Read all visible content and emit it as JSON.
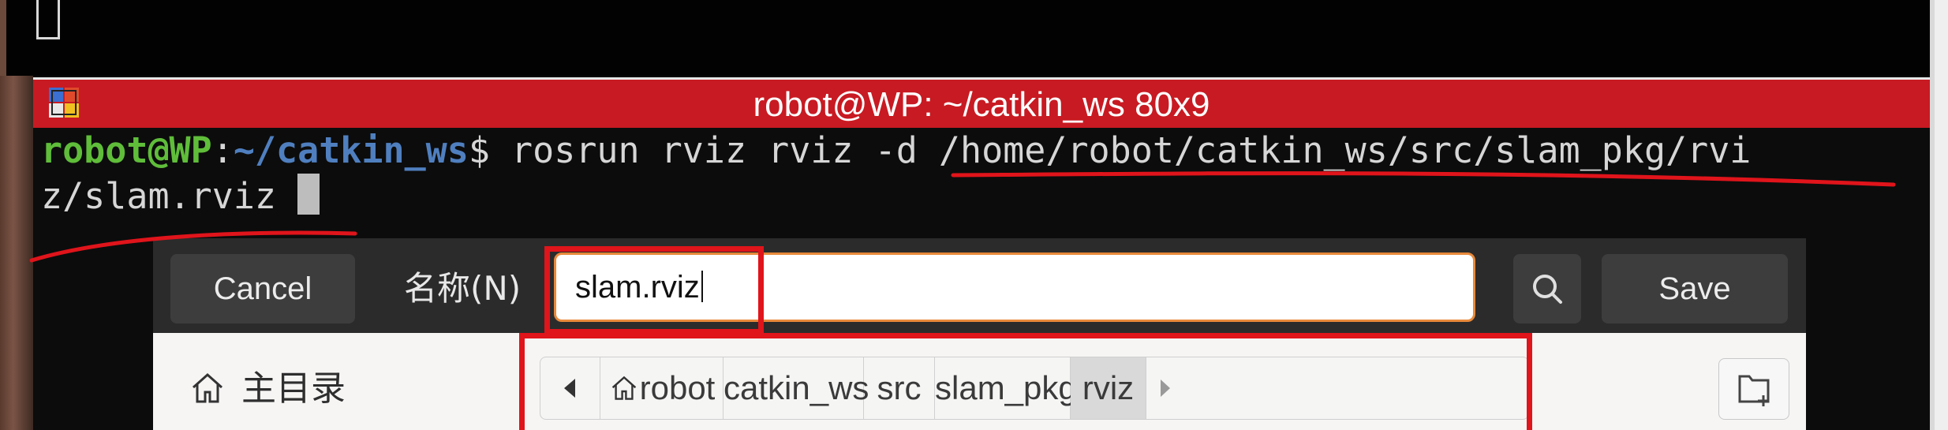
{
  "terminal": {
    "title": "robot@WP: ~/catkin_ws 80x9",
    "prompt_user": "robot@WP",
    "prompt_colon": ":",
    "prompt_path": "~/catkin_ws",
    "prompt_symbol": "$ ",
    "command_line1": "rosrun rviz rviz -d /home/robot/catkin_ws/src/slam_pkg/rvi",
    "command_line2": "z/slam.rviz "
  },
  "dialog": {
    "cancel_label": "Cancel",
    "name_label": "名称(N)",
    "name_value": "slam.rviz",
    "save_label": "Save",
    "sidebar_home_label": "主目录",
    "breadcrumbs": [
      "robot",
      "catkin_ws",
      "src",
      "slam_pkg",
      "rviz"
    ],
    "active_crumb": "rviz"
  },
  "icons": {
    "search": "search-icon",
    "home": "home-icon",
    "back": "chevron-left-icon",
    "forward": "chevron-right-icon",
    "new_folder": "new-folder-icon",
    "terminal": "terminal-app-icon"
  },
  "colors": {
    "titlebar": "#c81a22",
    "prompt_user": "#5fbd3a",
    "prompt_path": "#4f7fbf",
    "annotation": "#e0141b",
    "input_focus": "#e8893a"
  }
}
